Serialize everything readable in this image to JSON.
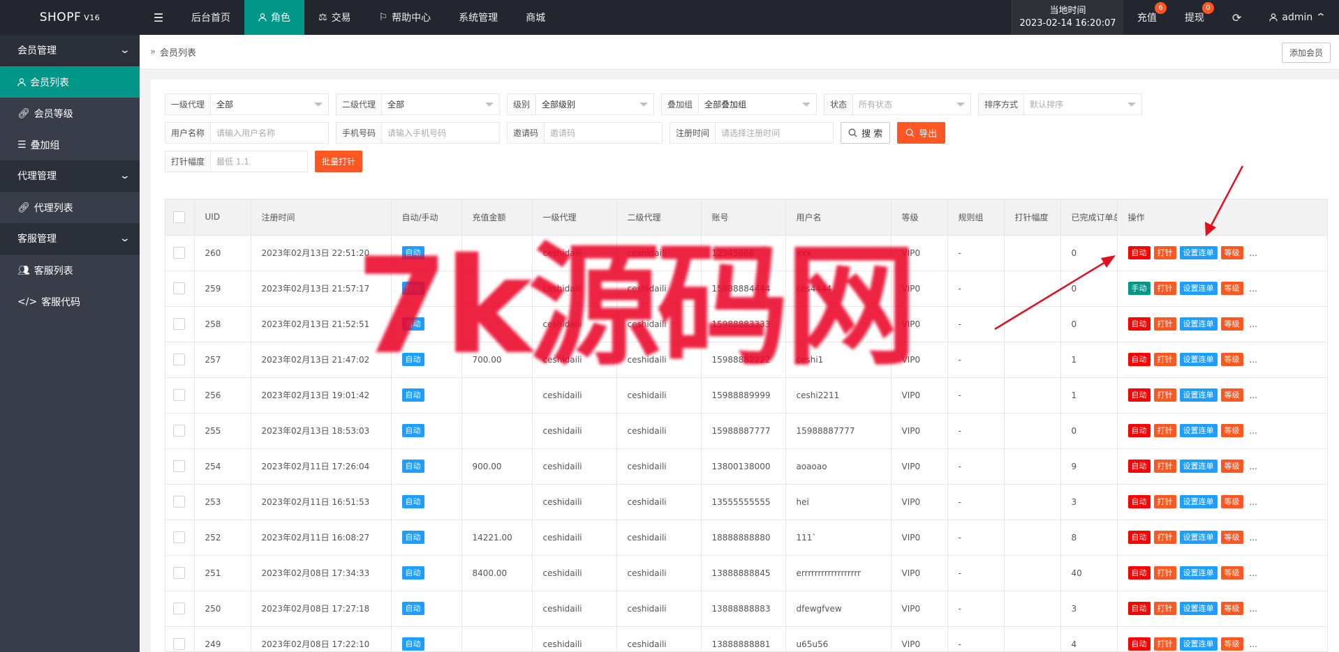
{
  "header": {
    "logo": "SHOPF",
    "version": "V16",
    "nav": [
      {
        "label": "后台首页",
        "icon": "home",
        "active": false
      },
      {
        "label": "角色",
        "icon": "user",
        "active": true
      },
      {
        "label": "交易",
        "icon": "scale",
        "active": false
      },
      {
        "label": "帮助中心",
        "icon": "flag",
        "active": false
      },
      {
        "label": "系统管理",
        "icon": "",
        "active": false
      },
      {
        "label": "商城",
        "icon": "",
        "active": false
      }
    ],
    "clock_label": "当地时间",
    "clock_value": "2023-02-14 16:20:07",
    "recharge": {
      "label": "充值",
      "badge": "6"
    },
    "withdraw": {
      "label": "提现",
      "badge": "0"
    },
    "user": "admin"
  },
  "sidebar": {
    "groups": [
      {
        "label": "会员管理",
        "items": [
          {
            "label": "会员列表",
            "icon": "user",
            "active": true
          },
          {
            "label": "会员等级",
            "icon": "link",
            "active": false
          },
          {
            "label": "叠加组",
            "icon": "list",
            "active": false
          }
        ]
      },
      {
        "label": "代理管理",
        "items": [
          {
            "label": "代理列表",
            "icon": "link",
            "active": false
          }
        ]
      },
      {
        "label": "客服管理",
        "items": [
          {
            "label": "客服列表",
            "icon": "users",
            "active": false
          },
          {
            "label": "客服代码",
            "icon": "code",
            "active": false
          }
        ]
      }
    ]
  },
  "breadcrumb": "会员列表",
  "add_member": "添加会员",
  "filters": {
    "agent1": {
      "label": "一级代理",
      "value": "全部"
    },
    "agent2": {
      "label": "二级代理",
      "value": "全部"
    },
    "level": {
      "label": "级别",
      "value": "全部级别"
    },
    "group": {
      "label": "叠加组",
      "value": "全部叠加组"
    },
    "status": {
      "label": "状态",
      "placeholder": "所有状态"
    },
    "sort": {
      "label": "排序方式",
      "placeholder": "默认排序"
    },
    "username": {
      "label": "用户名称",
      "placeholder": "请输入用户名称"
    },
    "phone": {
      "label": "手机号码",
      "placeholder": "请输入手机号码"
    },
    "invite": {
      "label": "邀请码",
      "placeholder": "邀请码"
    },
    "regtime": {
      "label": "注册时间",
      "placeholder": "请选择注册时间"
    },
    "search": "搜 索",
    "export": "导出",
    "amp": {
      "label": "打针幅度",
      "placeholder": "最低 1.1"
    },
    "batch": "批量打针"
  },
  "table": {
    "columns": [
      "UID",
      "注册时间",
      "自动/手动",
      "充值金额",
      "一级代理",
      "二级代理",
      "账号",
      "用户名",
      "等级",
      "规则组",
      "打针幅度",
      "已完成订单总",
      "操作"
    ],
    "rows": [
      {
        "uid": "260",
        "time": "2023年02月13日 22:51:20",
        "mode": "自动",
        "amount": "",
        "agent1": "ceshidaili",
        "agent2": "ceshidaili",
        "account": "12345666",
        "name": "xxx",
        "level": "VIP0",
        "rule": "-",
        "amp": "",
        "orders": "0",
        "op_mode": "自动"
      },
      {
        "uid": "259",
        "time": "2023年02月13日 21:57:17",
        "mode": "自动",
        "amount": "",
        "agent1": "ceshidaili",
        "agent2": "ceshidaili",
        "account": "15988884444",
        "name": "ces4444",
        "level": "VIP0",
        "rule": "-",
        "amp": "",
        "orders": "0",
        "op_mode": "手动"
      },
      {
        "uid": "258",
        "time": "2023年02月13日 21:52:51",
        "mode": "自动",
        "amount": "",
        "agent1": "ceshidaili",
        "agent2": "ceshidaili",
        "account": "15988883333",
        "name": "",
        "level": "VIP0",
        "rule": "-",
        "amp": "",
        "orders": "0",
        "op_mode": "自动"
      },
      {
        "uid": "257",
        "time": "2023年02月13日 21:47:02",
        "mode": "自动",
        "amount": "700.00",
        "agent1": "ceshidaili",
        "agent2": "ceshidaili",
        "account": "15988882222",
        "name": "ceshi1",
        "level": "VIP0",
        "rule": "-",
        "amp": "",
        "orders": "1",
        "op_mode": "自动"
      },
      {
        "uid": "256",
        "time": "2023年02月13日 19:01:42",
        "mode": "自动",
        "amount": "",
        "agent1": "ceshidaili",
        "agent2": "ceshidaili",
        "account": "15988889999",
        "name": "ceshi2211",
        "level": "VIP0",
        "rule": "-",
        "amp": "",
        "orders": "1",
        "op_mode": "自动"
      },
      {
        "uid": "255",
        "time": "2023年02月13日 18:53:03",
        "mode": "自动",
        "amount": "",
        "agent1": "ceshidaili",
        "agent2": "ceshidaili",
        "account": "15988887777",
        "name": "15988887777",
        "level": "VIP0",
        "rule": "-",
        "amp": "",
        "orders": "0",
        "op_mode": "自动"
      },
      {
        "uid": "254",
        "time": "2023年02月11日 17:26:04",
        "mode": "自动",
        "amount": "900.00",
        "agent1": "ceshidaili",
        "agent2": "ceshidaili",
        "account": "13800138000",
        "name": "aoaoao",
        "level": "VIP0",
        "rule": "-",
        "amp": "",
        "orders": "9",
        "op_mode": "自动"
      },
      {
        "uid": "253",
        "time": "2023年02月11日 16:51:53",
        "mode": "自动",
        "amount": "",
        "agent1": "ceshidaili",
        "agent2": "ceshidaili",
        "account": "13555555555",
        "name": "hei",
        "level": "VIP0",
        "rule": "-",
        "amp": "",
        "orders": "3",
        "op_mode": "自动"
      },
      {
        "uid": "252",
        "time": "2023年02月11日 16:08:27",
        "mode": "自动",
        "amount": "14221.00",
        "agent1": "ceshidaili",
        "agent2": "ceshidaili",
        "account": "18888888880",
        "name": "111`",
        "level": "VIP0",
        "rule": "-",
        "amp": "",
        "orders": "8",
        "op_mode": "自动"
      },
      {
        "uid": "251",
        "time": "2023年02月08日 17:34:33",
        "mode": "自动",
        "amount": "8400.00",
        "agent1": "ceshidaili",
        "agent2": "ceshidaili",
        "account": "13888888845",
        "name": "errrrrrrrrrrrrrrrrr",
        "level": "VIP0",
        "rule": "-",
        "amp": "",
        "orders": "40",
        "op_mode": "自动"
      },
      {
        "uid": "250",
        "time": "2023年02月08日 17:27:18",
        "mode": "自动",
        "amount": "",
        "agent1": "ceshidaili",
        "agent2": "ceshidaili",
        "account": "13888888883",
        "name": "dfewgfvew",
        "level": "VIP0",
        "rule": "-",
        "amp": "",
        "orders": "3",
        "op_mode": "自动"
      },
      {
        "uid": "249",
        "time": "2023年02月08日 17:22:10",
        "mode": "自动",
        "amount": "",
        "agent1": "ceshidaili",
        "agent2": "ceshidaili",
        "account": "13888888881",
        "name": "u65u56",
        "level": "VIP0",
        "rule": "-",
        "amp": "",
        "orders": "4",
        "op_mode": "自动"
      }
    ],
    "op_labels": {
      "inject": "打针",
      "link": "设置连单",
      "level": "等级",
      "more": "..."
    }
  },
  "watermark": "7k源码网",
  "colors": {
    "accent": "#009688",
    "danger": "#ff0000",
    "warn": "#ff5722",
    "info": "#1e9fff",
    "header": "#23262e",
    "sidebar": "#393d49"
  }
}
